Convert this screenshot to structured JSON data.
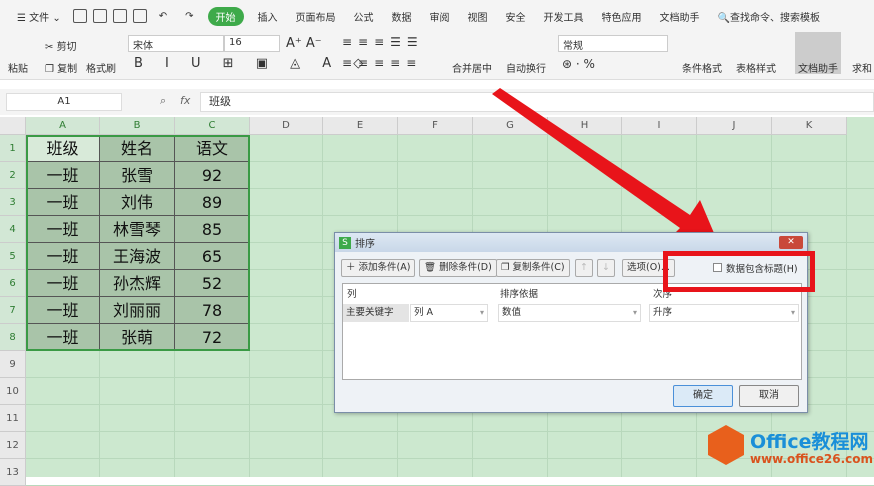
{
  "menubar": {
    "file": "文件",
    "tabs": [
      "开始",
      "插入",
      "页面布局",
      "公式",
      "数据",
      "审阅",
      "视图",
      "安全",
      "开发工具",
      "特色应用",
      "文档助手"
    ],
    "search": "查找命令、搜索模板"
  },
  "ribbon": {
    "paste": "粘贴",
    "cut": "剪切",
    "copy": "复制",
    "format_painter": "格式刷",
    "font": "宋体",
    "size": "16",
    "merge": "合并居中",
    "wrap": "自动换行",
    "number_format": "常规",
    "cond_format": "条件格式",
    "table_style": "表格样式",
    "doc_helper": "文档助手",
    "sum": "求和"
  },
  "formula_bar": {
    "cell_ref": "A1",
    "fx": "fx",
    "value": "班级"
  },
  "columns": [
    "A",
    "B",
    "C",
    "D",
    "E",
    "F",
    "G",
    "H",
    "I",
    "J",
    "K"
  ],
  "rows": [
    "1",
    "2",
    "3",
    "4",
    "5",
    "6",
    "7",
    "8",
    "9",
    "10",
    "11",
    "12",
    "13"
  ],
  "table": [
    [
      "班级",
      "姓名",
      "语文"
    ],
    [
      "一班",
      "张雪",
      "92"
    ],
    [
      "一班",
      "刘伟",
      "89"
    ],
    [
      "一班",
      "林雪琴",
      "85"
    ],
    [
      "一班",
      "王海波",
      "65"
    ],
    [
      "一班",
      "孙杰辉",
      "52"
    ],
    [
      "一班",
      "刘丽丽",
      "78"
    ],
    [
      "一班",
      "张萌",
      "72"
    ]
  ],
  "dialog": {
    "title": "排序",
    "add": "添加条件(A)",
    "delete": "删除条件(D)",
    "copy": "复制条件(C)",
    "options": "选项(O)...",
    "has_header": "数据包含标题(H)",
    "has_header_checked": false,
    "col_header": "列",
    "basis_header": "排序依据",
    "order_header": "次序",
    "key_label": "主要关键字",
    "key_col": "列 A",
    "basis": "数值",
    "order": "升序",
    "ok": "确定",
    "cancel": "取消"
  },
  "watermark": {
    "title": "Office教程网",
    "url": "www.office26.com"
  },
  "colors": {
    "accent": "#3eaa4a",
    "highlight": "#e8141a",
    "sheet_bg": "#cce8cf"
  }
}
